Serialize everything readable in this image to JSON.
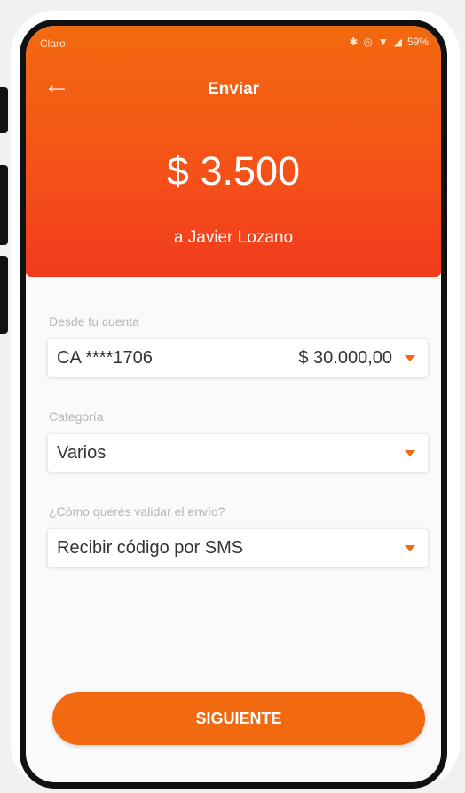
{
  "status_bar": {
    "carrier": "Claro",
    "icons": [
      "bluetooth-icon",
      "vibrate-icon",
      "wifi-icon",
      "signal-icon",
      "battery-icon"
    ],
    "battery_percent": "59%"
  },
  "header": {
    "title": "Enviar",
    "amount": "$ 3.500",
    "recipient": "a Javier Lozano"
  },
  "form": {
    "account": {
      "label": "Desde tu cuenta",
      "value": "CA ****1706",
      "balance": "$ 30.000,00"
    },
    "category": {
      "label": "Categoría",
      "value": "Varios"
    },
    "validation": {
      "label": "¿Cómo querés validar el envío?",
      "value": "Recibir código por SMS"
    }
  },
  "actions": {
    "next_label": "SIGUIENTE"
  },
  "colors": {
    "accent": "#f26a0f",
    "gradient_bottom": "#f23a1d"
  }
}
